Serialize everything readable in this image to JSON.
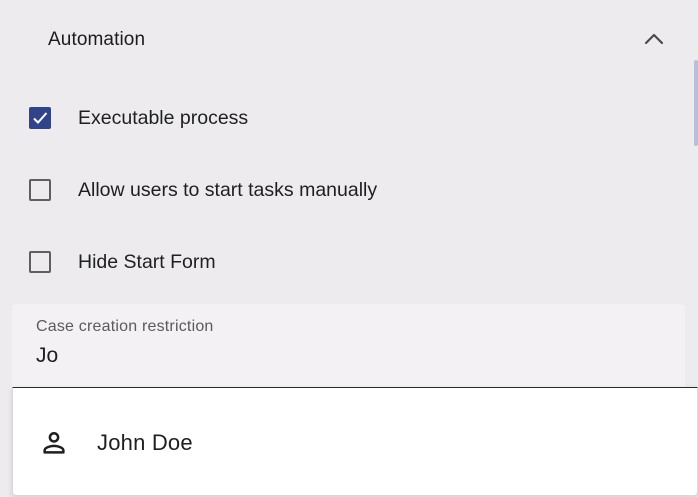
{
  "automation": {
    "title": "Automation",
    "expand_icon": "chevron-up-icon"
  },
  "options": [
    {
      "label": "Executable process",
      "checked": true
    },
    {
      "label": "Allow users to start tasks manually",
      "checked": false
    },
    {
      "label": "Hide Start Form",
      "checked": false
    }
  ],
  "case_restriction": {
    "label": "Case creation restriction",
    "value": "Jo"
  },
  "suggestions": [
    {
      "icon": "person-icon",
      "label": "John Doe"
    }
  ],
  "colors": {
    "accent": "#31448a",
    "background": "#edebee",
    "field_background": "#f4f1f4"
  }
}
